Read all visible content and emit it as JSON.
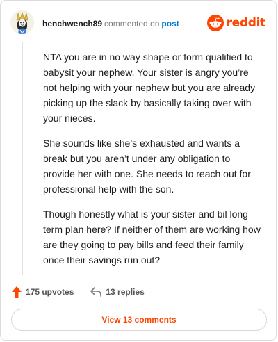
{
  "comment": {
    "username": "henchwench89",
    "action_text": "commented on",
    "post_link": "post",
    "paragraphs": [
      "NTA you are in no way shape or form qualified to babysit your nephew. Your sister is angry you’re not helping with your nephew but you are already picking up the slack by basically taking over with your nieces.",
      "She sounds like she’s exhausted and wants a break but you aren’t under any obligation to provide her with one. She needs to reach out for professional help with the son.",
      "Though honestly what is your sister and bil long term plan here? If neither of them are working how are they going to pay bills and feed their family once their savings run out?"
    ],
    "upvotes_label": "175 upvotes",
    "replies_label": "13 replies",
    "view_comments_label": "View 13 comments"
  },
  "brand": {
    "wordmark": "reddit",
    "icon": "reddit-snoo-icon",
    "color": "#ff4500"
  },
  "colors": {
    "accent": "#ff4500",
    "link": "#0079d3",
    "muted": "#7c7c7c"
  }
}
